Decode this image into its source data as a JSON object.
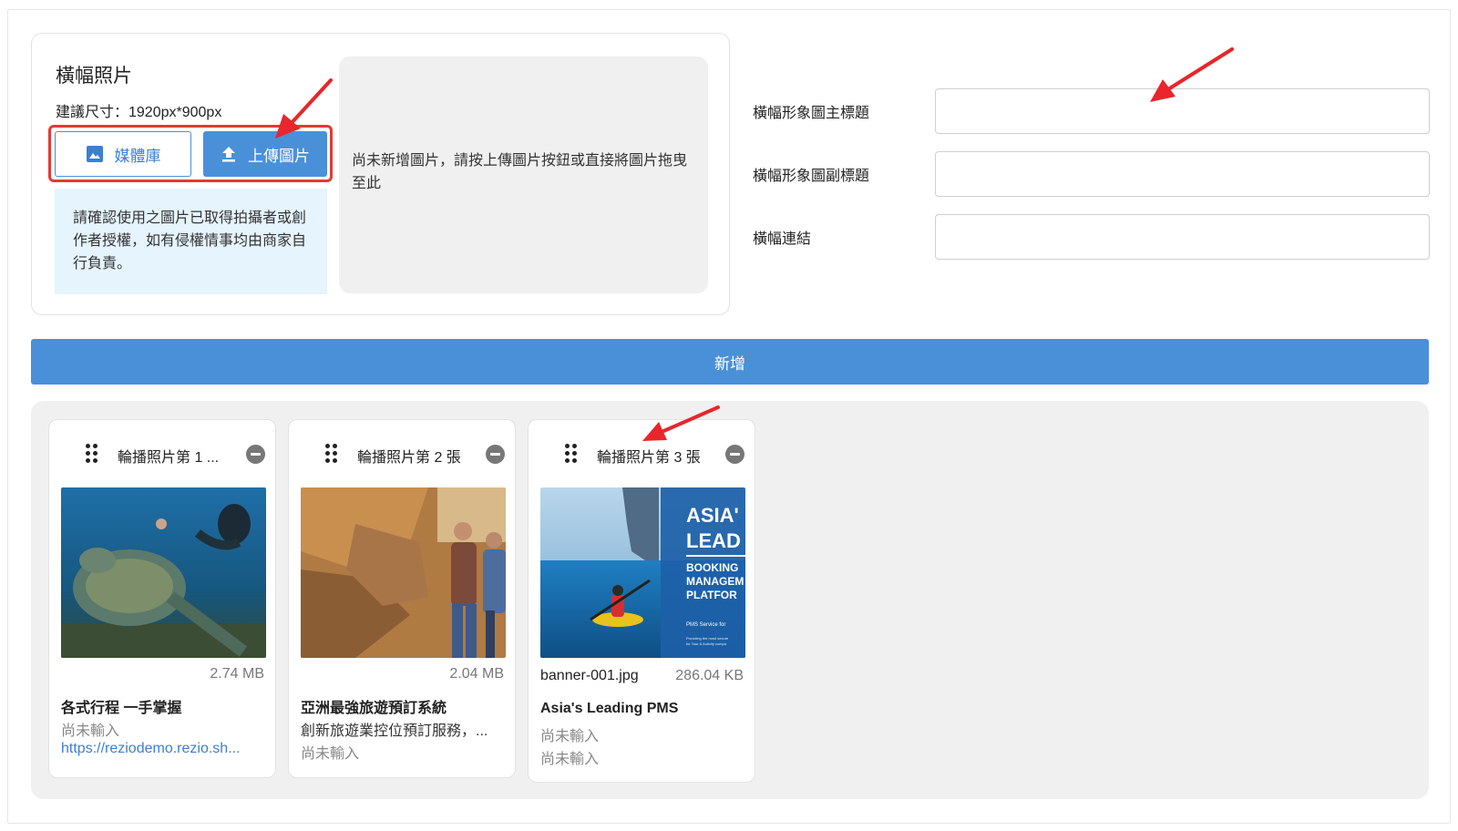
{
  "upload": {
    "title": "橫幅照片",
    "size_hint": "建議尺寸：1920px*900px",
    "media_button_label": "媒體庫",
    "upload_button_label": "上傳圖片",
    "notice": "請確認使用之圖片已取得拍攝者或創作者授權，如有侵權情事均由商家自行負責。",
    "dropzone_text": "尚未新增圖片，請按上傳圖片按鈕或直接將圖片拖曳至此"
  },
  "fields": {
    "main_title_label": "橫幅形象圖主標題",
    "main_title_value": "",
    "sub_title_label": "橫幅形象圖副標題",
    "sub_title_value": "",
    "link_label": "橫幅連結",
    "link_value": ""
  },
  "add_button_label": "新增",
  "slides": [
    {
      "title": "輪播照片第 1 ...",
      "image": "sea-turtle-diver-photo",
      "size": "2.74 MB",
      "filename": "",
      "main_title": "各式行程 一手掌握",
      "sub_title": "尚未輸入",
      "link": "https://reziodemo.rezio.sh..."
    },
    {
      "title": "輪播照片第 2 張",
      "image": "hikers-rock-photo",
      "size": "2.04 MB",
      "filename": "",
      "main_title": "亞洲最強旅遊預訂系統",
      "sub_title": "創新旅遊業控位預訂服務，...",
      "link": "尚未輸入"
    },
    {
      "title": "輪播照片第 3 張",
      "image": "kayak-banner-photo",
      "size": "286.04 KB",
      "filename": "banner-001.jpg",
      "main_title": "Asia's Leading PMS",
      "sub_title": "尚未輸入",
      "link": "尚未輸入",
      "banner_text": {
        "line1": "ASIA'",
        "line2": "LEAD",
        "line3": "BOOKING",
        "line4": "MANAGEM",
        "line5": "PLATFOR",
        "line6": "PMS Service for",
        "line7": "Providing the most secure",
        "line8": "for Tour & Activity compa"
      }
    }
  ],
  "icons": [
    "image-icon",
    "upload-icon",
    "drag-handle-icon",
    "remove-icon",
    "red-arrow-annotation"
  ],
  "colors": {
    "primary": "#4a90d9",
    "highlight": "#e53935",
    "notice_bg": "#e5f4fd",
    "panel_bg": "#f0f0f0"
  }
}
